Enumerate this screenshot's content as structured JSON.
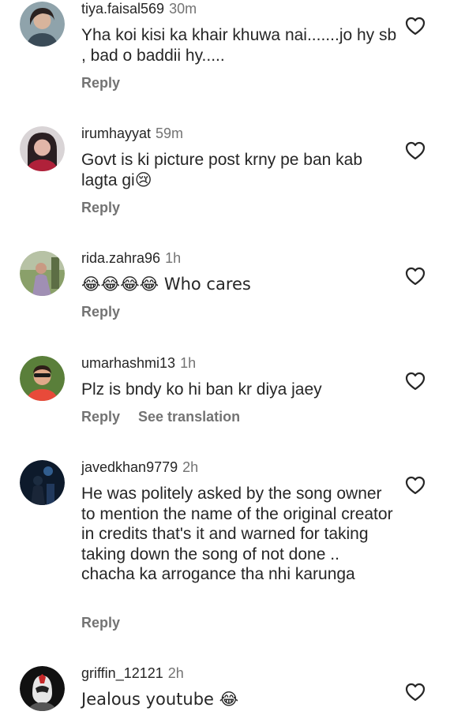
{
  "comments": [
    {
      "username": "tiya.faisal569",
      "time": "30m",
      "text": "Yha koi kisi ka khair khuwa nai.......jo hy sb , bad o baddii hy.....",
      "actions": [
        "Reply"
      ],
      "avatar_icon": "profile-photo"
    },
    {
      "username": "irumhayyat",
      "time": "59m",
      "text": "Govt is ki picture post krny pe ban kab lagta gi😢",
      "actions": [
        "Reply"
      ],
      "avatar_icon": "profile-photo"
    },
    {
      "username": "rida.zahra96",
      "time": "1h",
      "text": "😂😂😂😂 Who cares",
      "actions": [
        "Reply"
      ],
      "avatar_icon": "profile-photo"
    },
    {
      "username": "umarhashmi13",
      "time": "1h",
      "text": "Plz is bndy ko hi ban kr diya jaey",
      "actions": [
        "Reply",
        "See translation"
      ],
      "avatar_icon": "profile-photo"
    },
    {
      "username": "javedkhan9779",
      "time": "2h",
      "text": "He was politely asked by the song owner to mention the name of the original creator in credits that's it and warned for taking taking down the song of not done .. chacha ka arrogance tha nhi karunga",
      "actions": [
        "Reply"
      ],
      "avatar_icon": "profile-photo"
    },
    {
      "username": "griffin_12121",
      "time": "2h",
      "text": "Jealous youtube 😂",
      "actions": [],
      "avatar_icon": "profile-photo"
    }
  ],
  "colors": {
    "text": "#262626",
    "secondary": "#737373"
  },
  "icons": {
    "like": "heart-outline-icon"
  }
}
